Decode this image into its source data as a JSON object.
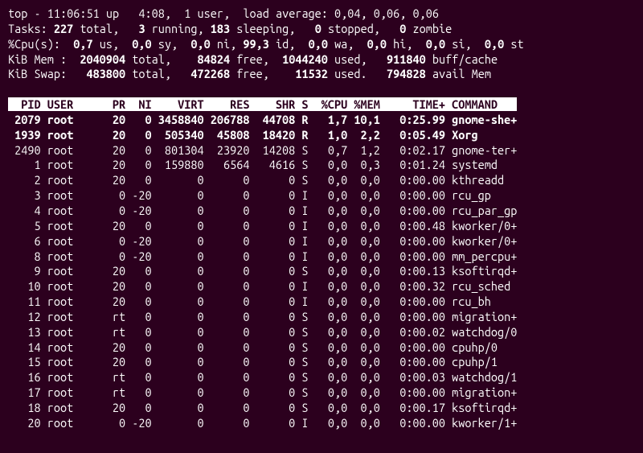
{
  "summary": {
    "line1": {
      "prefix": "top - ",
      "time": "11:06:51",
      "up_label": " up  ",
      "uptime": " 4:08",
      "users": ",  1 user,  load average: 0,04, 0,06, 0,06"
    },
    "line2": {
      "tasks_label": "Tasks:",
      "total": " 227 ",
      "total_label": "total,   ",
      "running": "3 ",
      "running_label": "running, ",
      "sleeping": "183 ",
      "sleeping_label": "sleeping,   ",
      "stopped": "0 ",
      "stopped_label": "stopped,   ",
      "zombie": "0 ",
      "zombie_label": "zombie"
    },
    "line3": {
      "label": "%Cpu(s):  ",
      "us": "0,7 ",
      "us_label": "us,  ",
      "sy": "0,0 ",
      "sy_label": "sy,  ",
      "ni": "0,0 ",
      "ni_label": "ni, ",
      "id": "99,3 ",
      "id_label": "id,  ",
      "wa": "0,0 ",
      "wa_label": "wa,  ",
      "hi": "0,0 ",
      "hi_label": "hi,  ",
      "si": "0,0 ",
      "si_label": "si,  ",
      "st": "0,0 ",
      "st_label": "st"
    },
    "line4": {
      "label": "KiB Mem : ",
      "total": " 2040904 ",
      "total_label": "total,   ",
      "free": " 84824 ",
      "free_label": "free,  ",
      "used": "1044240 ",
      "used_label": "used,   ",
      "buff": "911840 ",
      "buff_label": "buff/cache"
    },
    "line5": {
      "label": "KiB Swap:  ",
      "total": " 483800 ",
      "total_label": "total,   ",
      "free": "472268 ",
      "free_label": "free,    ",
      "used": "11532 ",
      "used_label": "used.   ",
      "avail": "794828 ",
      "avail_label": "avail Mem"
    }
  },
  "columns": [
    "PID",
    "USER",
    "PR",
    "NI",
    "VIRT",
    "RES",
    "SHR",
    "S",
    "%CPU",
    "%MEM",
    "TIME+",
    "COMMAND"
  ],
  "header_line": "  PID USER      PR  NI    VIRT    RES    SHR S  %CPU %MEM     TIME+ COMMAND   ",
  "rows": [
    {
      "bold": true,
      "pid": " 2079",
      "user": "root",
      "pr": "20",
      "ni": "  0",
      "virt": "3458840",
      "res": "206788",
      "shr": " 44708",
      "s": "R",
      "cpu": " 1,7",
      "mem": "10,1",
      "time": "  0:25.99",
      "cmd": "gnome-she+"
    },
    {
      "bold": true,
      "pid": " 1939",
      "user": "root",
      "pr": "20",
      "ni": "  0",
      "virt": " 505340",
      "res": " 45808",
      "shr": " 18420",
      "s": "R",
      "cpu": " 1,0",
      "mem": " 2,2",
      "time": "  0:05.49",
      "cmd": "Xorg"
    },
    {
      "bold": false,
      "pid": " 2490",
      "user": "root",
      "pr": "20",
      "ni": "  0",
      "virt": " 801304",
      "res": " 23920",
      "shr": " 14208",
      "s": "S",
      "cpu": " 0,7",
      "mem": " 1,2",
      "time": "  0:02.17",
      "cmd": "gnome-ter+"
    },
    {
      "bold": false,
      "pid": "    1",
      "user": "root",
      "pr": "20",
      "ni": "  0",
      "virt": " 159880",
      "res": "  6564",
      "shr": "  4616",
      "s": "S",
      "cpu": " 0,0",
      "mem": " 0,3",
      "time": "  0:01.24",
      "cmd": "systemd"
    },
    {
      "bold": false,
      "pid": "    2",
      "user": "root",
      "pr": "20",
      "ni": "  0",
      "virt": "      0",
      "res": "     0",
      "shr": "     0",
      "s": "S",
      "cpu": " 0,0",
      "mem": " 0,0",
      "time": "  0:00.00",
      "cmd": "kthreadd"
    },
    {
      "bold": false,
      "pid": "    3",
      "user": "root",
      "pr": " 0",
      "ni": "-20",
      "virt": "      0",
      "res": "     0",
      "shr": "     0",
      "s": "I",
      "cpu": " 0,0",
      "mem": " 0,0",
      "time": "  0:00.00",
      "cmd": "rcu_gp"
    },
    {
      "bold": false,
      "pid": "    4",
      "user": "root",
      "pr": " 0",
      "ni": "-20",
      "virt": "      0",
      "res": "     0",
      "shr": "     0",
      "s": "I",
      "cpu": " 0,0",
      "mem": " 0,0",
      "time": "  0:00.00",
      "cmd": "rcu_par_gp"
    },
    {
      "bold": false,
      "pid": "    5",
      "user": "root",
      "pr": "20",
      "ni": "  0",
      "virt": "      0",
      "res": "     0",
      "shr": "     0",
      "s": "I",
      "cpu": " 0,0",
      "mem": " 0,0",
      "time": "  0:00.48",
      "cmd": "kworker/0+"
    },
    {
      "bold": false,
      "pid": "    6",
      "user": "root",
      "pr": " 0",
      "ni": "-20",
      "virt": "      0",
      "res": "     0",
      "shr": "     0",
      "s": "I",
      "cpu": " 0,0",
      "mem": " 0,0",
      "time": "  0:00.00",
      "cmd": "kworker/0+"
    },
    {
      "bold": false,
      "pid": "    8",
      "user": "root",
      "pr": " 0",
      "ni": "-20",
      "virt": "      0",
      "res": "     0",
      "shr": "     0",
      "s": "I",
      "cpu": " 0,0",
      "mem": " 0,0",
      "time": "  0:00.00",
      "cmd": "mm_percpu+"
    },
    {
      "bold": false,
      "pid": "    9",
      "user": "root",
      "pr": "20",
      "ni": "  0",
      "virt": "      0",
      "res": "     0",
      "shr": "     0",
      "s": "S",
      "cpu": " 0,0",
      "mem": " 0,0",
      "time": "  0:00.13",
      "cmd": "ksoftirqd+"
    },
    {
      "bold": false,
      "pid": "   10",
      "user": "root",
      "pr": "20",
      "ni": "  0",
      "virt": "      0",
      "res": "     0",
      "shr": "     0",
      "s": "I",
      "cpu": " 0,0",
      "mem": " 0,0",
      "time": "  0:00.32",
      "cmd": "rcu_sched"
    },
    {
      "bold": false,
      "pid": "   11",
      "user": "root",
      "pr": "20",
      "ni": "  0",
      "virt": "      0",
      "res": "     0",
      "shr": "     0",
      "s": "I",
      "cpu": " 0,0",
      "mem": " 0,0",
      "time": "  0:00.00",
      "cmd": "rcu_bh"
    },
    {
      "bold": false,
      "pid": "   12",
      "user": "root",
      "pr": "rt",
      "ni": "  0",
      "virt": "      0",
      "res": "     0",
      "shr": "     0",
      "s": "S",
      "cpu": " 0,0",
      "mem": " 0,0",
      "time": "  0:00.00",
      "cmd": "migration+"
    },
    {
      "bold": false,
      "pid": "   13",
      "user": "root",
      "pr": "rt",
      "ni": "  0",
      "virt": "      0",
      "res": "     0",
      "shr": "     0",
      "s": "S",
      "cpu": " 0,0",
      "mem": " 0,0",
      "time": "  0:00.02",
      "cmd": "watchdog/0"
    },
    {
      "bold": false,
      "pid": "   14",
      "user": "root",
      "pr": "20",
      "ni": "  0",
      "virt": "      0",
      "res": "     0",
      "shr": "     0",
      "s": "S",
      "cpu": " 0,0",
      "mem": " 0,0",
      "time": "  0:00.00",
      "cmd": "cpuhp/0"
    },
    {
      "bold": false,
      "pid": "   15",
      "user": "root",
      "pr": "20",
      "ni": "  0",
      "virt": "      0",
      "res": "     0",
      "shr": "     0",
      "s": "S",
      "cpu": " 0,0",
      "mem": " 0,0",
      "time": "  0:00.00",
      "cmd": "cpuhp/1"
    },
    {
      "bold": false,
      "pid": "   16",
      "user": "root",
      "pr": "rt",
      "ni": "  0",
      "virt": "      0",
      "res": "     0",
      "shr": "     0",
      "s": "S",
      "cpu": " 0,0",
      "mem": " 0,0",
      "time": "  0:00.03",
      "cmd": "watchdog/1"
    },
    {
      "bold": false,
      "pid": "   17",
      "user": "root",
      "pr": "rt",
      "ni": "  0",
      "virt": "      0",
      "res": "     0",
      "shr": "     0",
      "s": "S",
      "cpu": " 0,0",
      "mem": " 0,0",
      "time": "  0:00.00",
      "cmd": "migration+"
    },
    {
      "bold": false,
      "pid": "   18",
      "user": "root",
      "pr": "20",
      "ni": "  0",
      "virt": "      0",
      "res": "     0",
      "shr": "     0",
      "s": "S",
      "cpu": " 0,0",
      "mem": " 0,0",
      "time": "  0:00.17",
      "cmd": "ksoftirqd+"
    },
    {
      "bold": false,
      "pid": "   20",
      "user": "root",
      "pr": " 0",
      "ni": "-20",
      "virt": "      0",
      "res": "     0",
      "shr": "     0",
      "s": "I",
      "cpu": " 0,0",
      "mem": " 0,0",
      "time": "  0:00.00",
      "cmd": "kworker/1+"
    }
  ]
}
